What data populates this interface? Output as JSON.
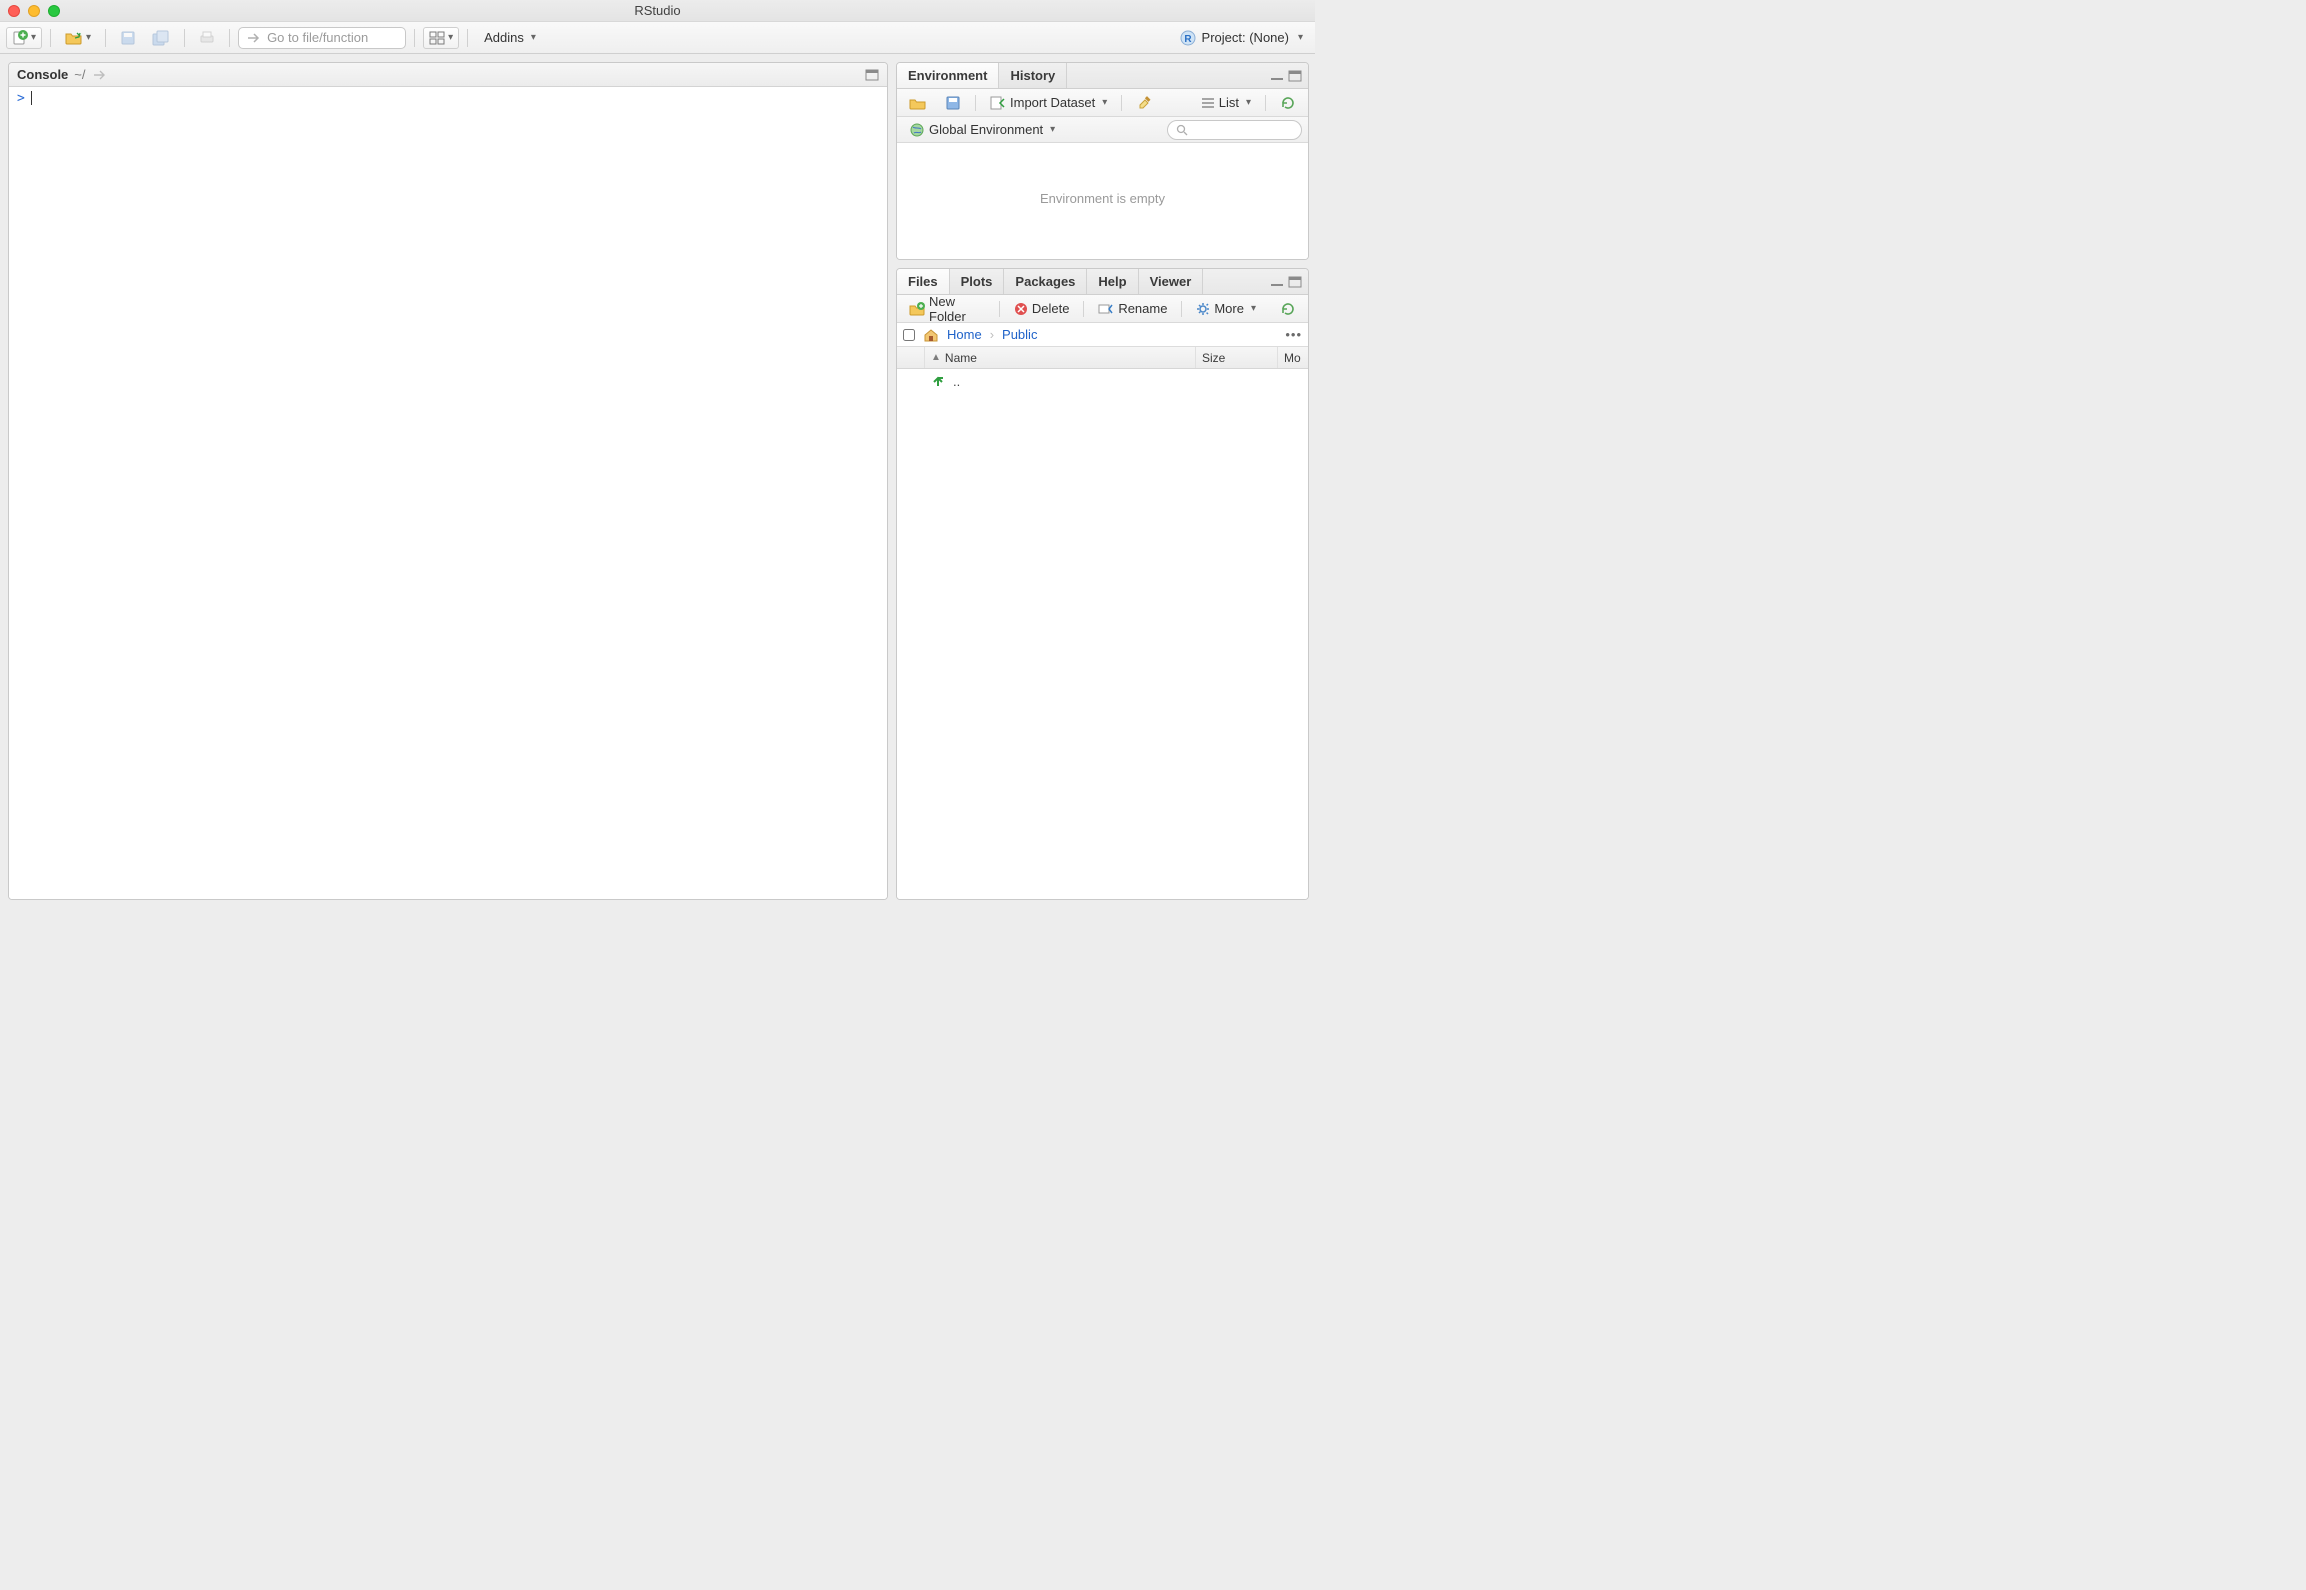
{
  "window": {
    "title": "RStudio"
  },
  "toolbar": {
    "gotofile_placeholder": "Go to file/function",
    "addins_label": "Addins",
    "project_label": "Project: (None)"
  },
  "console": {
    "title": "Console",
    "path": "~/",
    "prompt": ">"
  },
  "env": {
    "tabs": {
      "environment": "Environment",
      "history": "History"
    },
    "import_label": "Import Dataset",
    "list_label": "List",
    "scope_label": "Global Environment",
    "empty_msg": "Environment is empty"
  },
  "files": {
    "tabs": {
      "files": "Files",
      "plots": "Plots",
      "packages": "Packages",
      "help": "Help",
      "viewer": "Viewer"
    },
    "newfolder_label": "New Folder",
    "delete_label": "Delete",
    "rename_label": "Rename",
    "more_label": "More",
    "breadcrumb": {
      "home": "Home",
      "folder": "Public"
    },
    "cols": {
      "name": "Name",
      "size": "Size",
      "mod": "Mo"
    },
    "up_label": ".."
  }
}
